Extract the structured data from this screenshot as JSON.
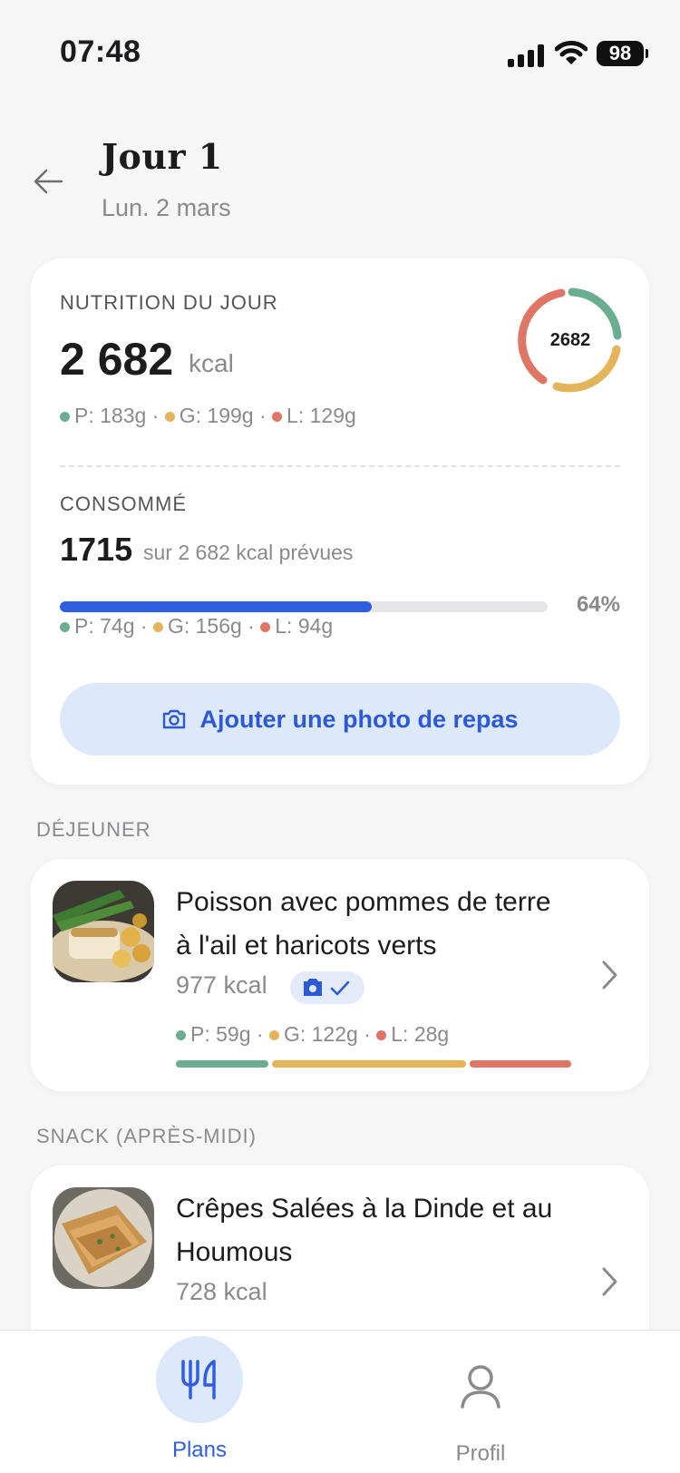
{
  "status_bar": {
    "time": "07:48",
    "battery": "98"
  },
  "header": {
    "title": "Jour 1",
    "date": "Lun. 2 mars"
  },
  "nutrition": {
    "heading": "NUTRITION DU JOUR",
    "kcal": "2 682",
    "kcal_unit": "kcal",
    "ring_value": "2682",
    "macros": {
      "p": "P: 183g",
      "g": "G: 199g",
      "l": "L: 129g"
    },
    "consumed_heading": "CONSOMMÉ",
    "consumed": "1715",
    "consumed_sub": "sur 2 682 kcal prévues",
    "progress_percent": 64,
    "progress_label": "64%",
    "consumed_macros": {
      "p": "P: 74g",
      "g": "G: 156g",
      "l": "L: 94g"
    },
    "photo_button": "Ajouter une photo de repas"
  },
  "sections": [
    {
      "label": "DÉJEUNER",
      "meal": {
        "name": "Poisson avec pommes de terre à l'ail et haricots verts",
        "kcal": "977 kcal",
        "macros": {
          "p": "P: 59g",
          "g": "G: 122g",
          "l": "L: 28g"
        }
      }
    },
    {
      "label": "SNACK (APRÈS-MIDI)",
      "meal": {
        "name": "Crêpes Salées à la Dinde et au Houmous",
        "kcal": "728 kcal"
      }
    }
  ],
  "tabs": [
    {
      "label": "Plans",
      "active": true,
      "icon": "fork-knife-icon"
    },
    {
      "label": "Profil",
      "active": false,
      "icon": "person-icon"
    }
  ],
  "colors": {
    "protein": "#6aad8f",
    "carbs": "#e3b45a",
    "fat": "#df7565",
    "accent": "#2f5fe0",
    "accent_soft": "#dde8fb"
  }
}
